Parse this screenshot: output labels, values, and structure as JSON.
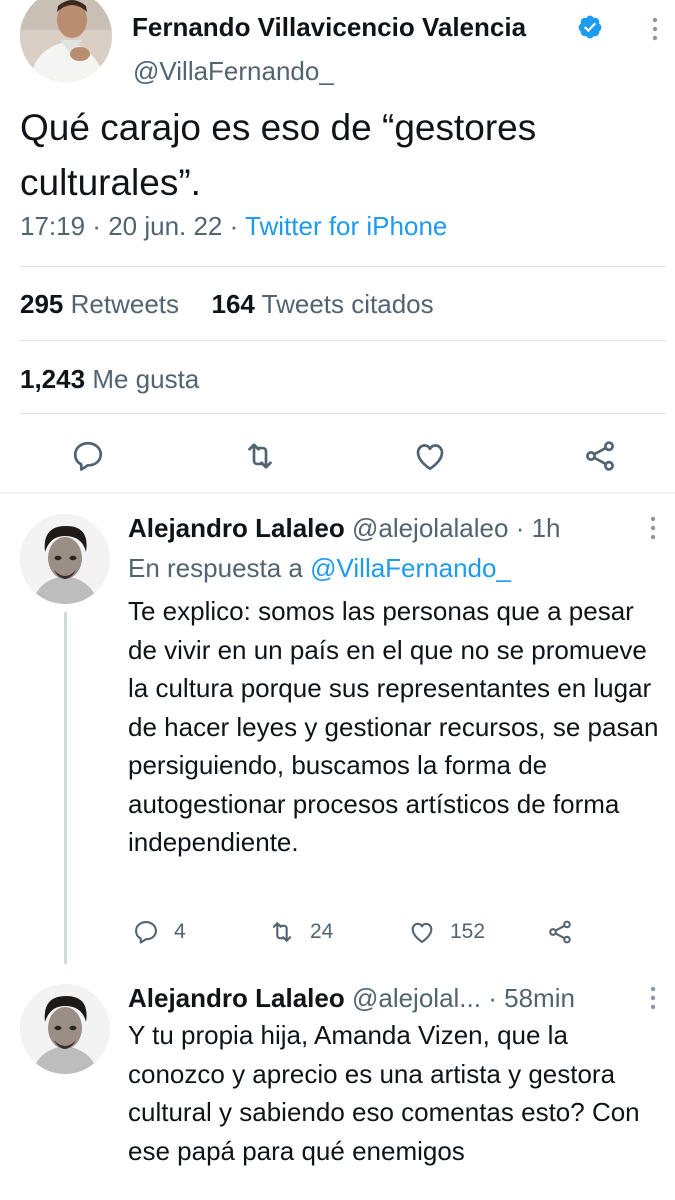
{
  "tweet": {
    "author_name": "Fernando Villavicencio Valencia",
    "author_handle": "@VillaFernando_",
    "text": "Qué carajo es eso de “gestores culturales”.",
    "time": "17:19",
    "date": "20 jun. 22",
    "source": "Twitter for iPhone",
    "retweets_count": "295",
    "retweets_label": "Retweets",
    "quotes_count": "164",
    "quotes_label": "Tweets citados",
    "likes_count": "1,243",
    "likes_label": "Me gusta",
    "icons": [
      "reply-icon",
      "retweet-icon",
      "like-icon",
      "share-icon"
    ],
    "verified_color": "#1d9bf0"
  },
  "replies": [
    {
      "author_name": "Alejandro Lalaleo",
      "author_handle": "@alejolalaleo",
      "time": "1h",
      "replying_to_label": "En respuesta a",
      "replying_to_handle": "@VillaFernando_",
      "text": "Te explico: somos las personas que a pesar de vivir en un país en el que no se promueve la cultura porque sus representantes en lugar de hacer leyes y gestionar recursos, se pasan persiguiendo, buscamos la forma de autogestionar procesos artísticos de forma independiente.",
      "reply_count": "4",
      "retweet_count": "24",
      "like_count": "152"
    },
    {
      "author_name": "Alejandro Lalaleo",
      "author_handle": "@alejolal...",
      "time": "58min",
      "text": "Y tu propia hija, Amanda Vizen, que la conozco y aprecio es una artista y gestora cultural y sabiendo eso comentas esto? Con ese papá para qué enemigos"
    }
  ],
  "colors": {
    "link": "#1d9bf0",
    "secondary_text": "#536471",
    "primary_text": "#0f1419",
    "divider": "#dfe3e6"
  }
}
